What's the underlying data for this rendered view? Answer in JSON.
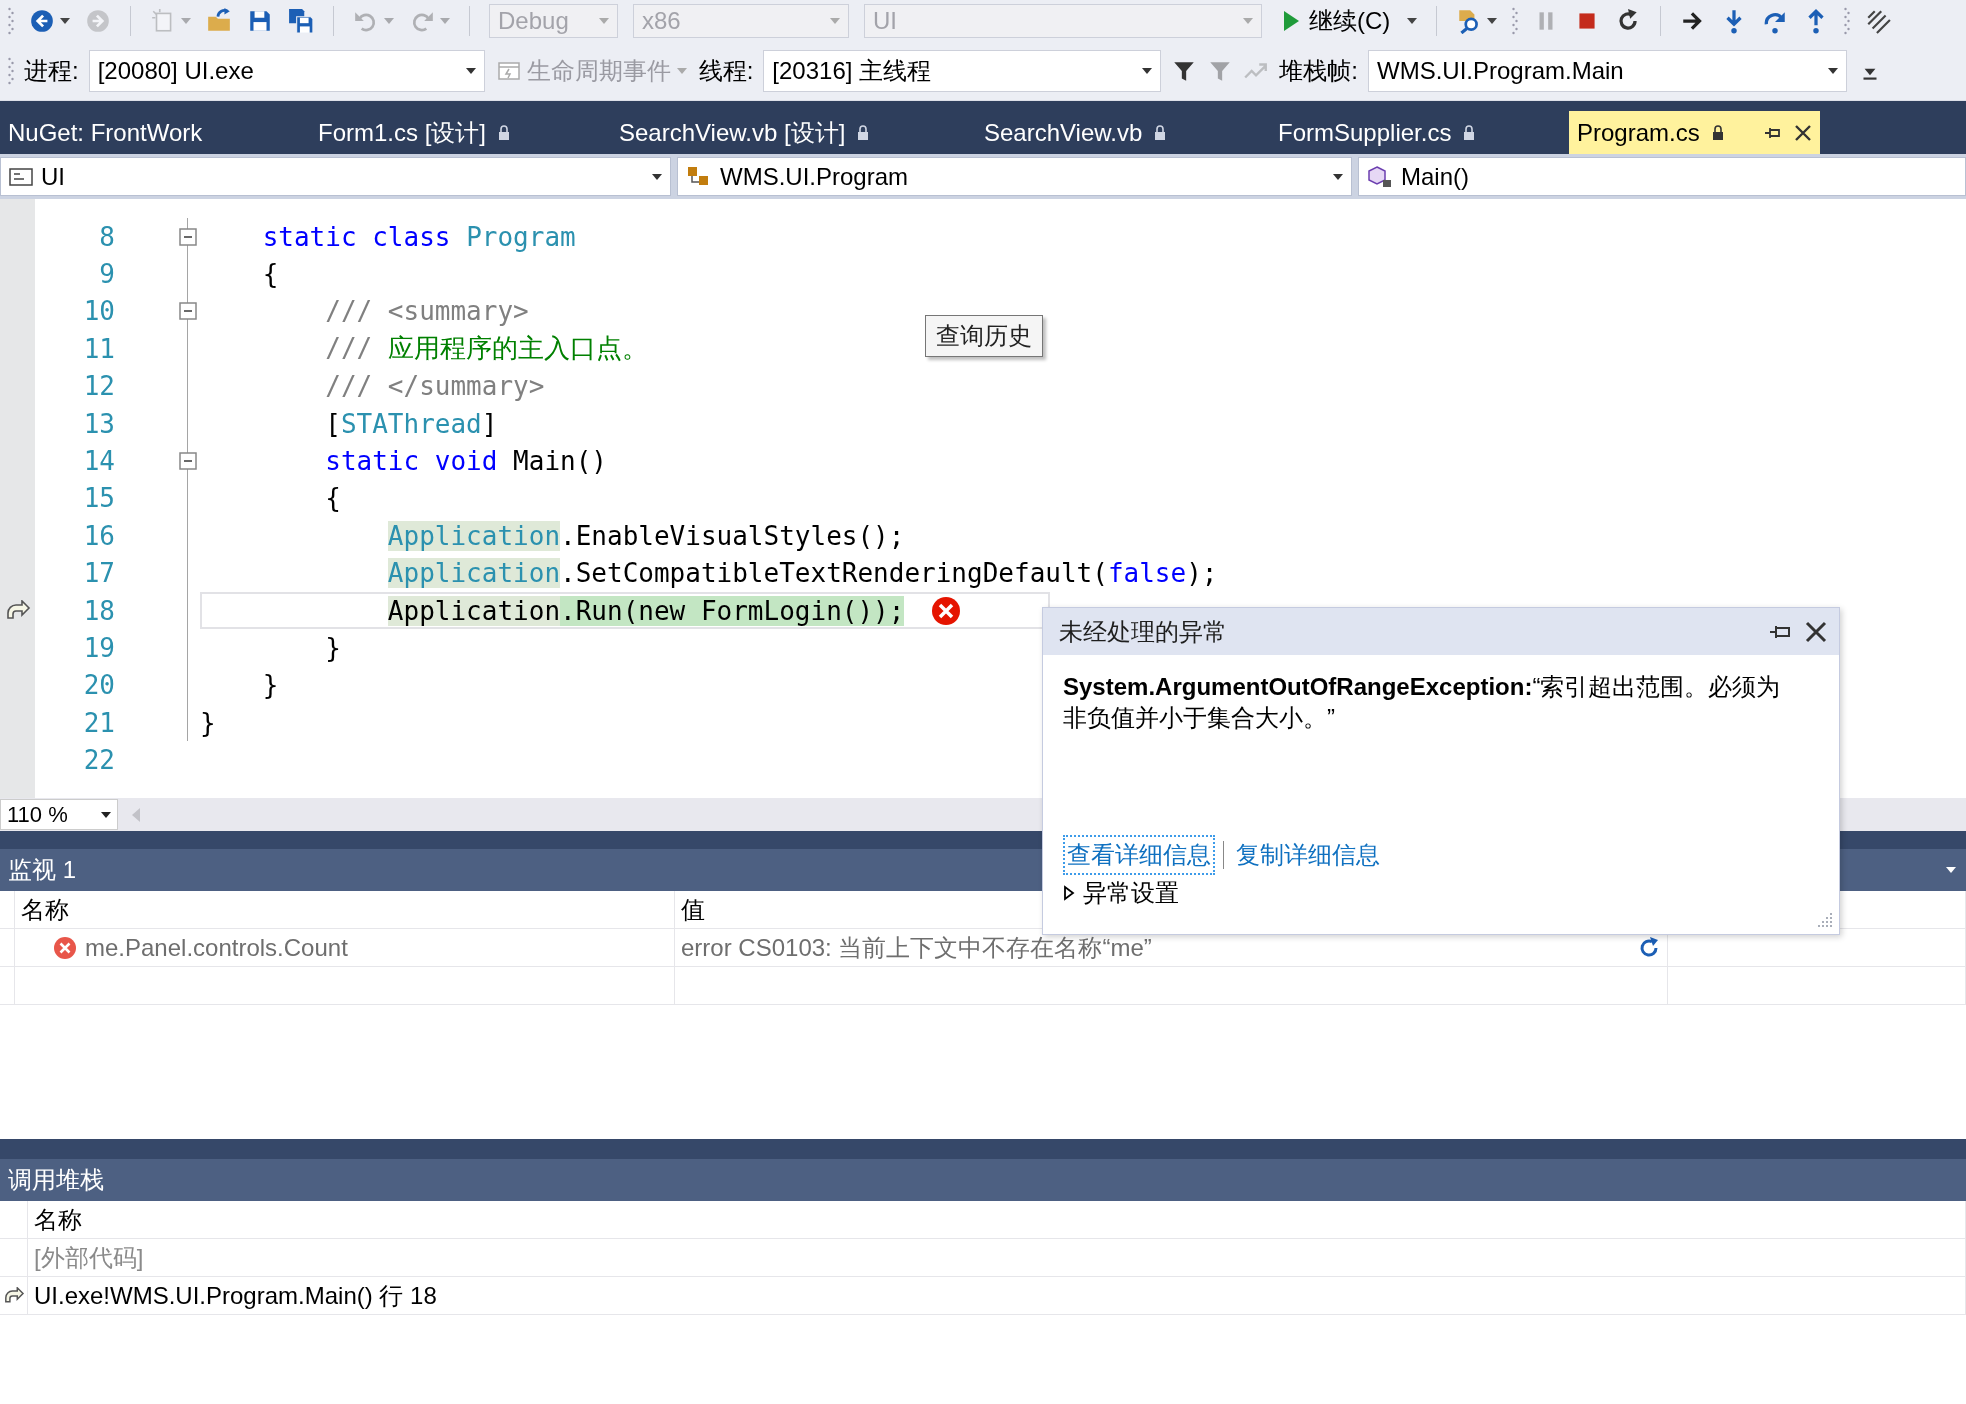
{
  "toolbar": {
    "rows": [
      {
        "items": [
          {
            "kind": "grip"
          },
          {
            "kind": "back",
            "disabled": false,
            "dropdown": true
          },
          {
            "kind": "forward",
            "disabled": true,
            "dropdown": false
          },
          {
            "kind": "separator"
          },
          {
            "kind": "new",
            "disabled": true,
            "dropdown": true
          },
          {
            "kind": "open",
            "disabled": false,
            "dropdown": false
          },
          {
            "kind": "save",
            "disabled": false,
            "dropdown": false
          },
          {
            "kind": "save-all",
            "disabled": false,
            "dropdown": false
          },
          {
            "kind": "separator"
          },
          {
            "kind": "undo",
            "disabled": true,
            "dropdown": true
          },
          {
            "kind": "redo",
            "disabled": true,
            "dropdown": true
          },
          {
            "kind": "separator"
          },
          {
            "kind": "combo",
            "value": "Debug",
            "disabled": true
          },
          {
            "kind": "combo",
            "value": "x86",
            "disabled": true
          },
          {
            "kind": "combo",
            "value": "UI",
            "disabled": true
          },
          {
            "kind": "continue",
            "label": "继续(C)",
            "disabled": false,
            "dropdown": true
          },
          {
            "kind": "separator"
          },
          {
            "kind": "find",
            "disabled": false,
            "dropdown": true
          },
          {
            "kind": "grip"
          },
          {
            "kind": "pause",
            "disabled": true,
            "dropdown": false
          },
          {
            "kind": "stop",
            "disabled": false,
            "dropdown": false
          },
          {
            "kind": "restart",
            "disabled": false,
            "dropdown": false
          },
          {
            "kind": "separator"
          },
          {
            "kind": "show-next",
            "disabled": false,
            "dropdown": false
          },
          {
            "kind": "step-into",
            "disabled": false,
            "dropdown": false
          },
          {
            "kind": "step-over",
            "disabled": false,
            "dropdown": false
          },
          {
            "kind": "step-out",
            "disabled": false,
            "dropdown": false
          },
          {
            "kind": "grip"
          },
          {
            "kind": "hex",
            "disabled": false,
            "dropdown": false
          }
        ]
      },
      {
        "items": [
          {
            "kind": "grip"
          },
          {
            "kind": "label",
            "text": "进程:"
          },
          {
            "kind": "combo",
            "value": "[20080] UI.exe",
            "disabled": false
          },
          {
            "kind": "lifecycle",
            "label": "生命周期事件",
            "disabled": true,
            "dropdown": true
          },
          {
            "kind": "label",
            "text": "线程:"
          },
          {
            "kind": "combo",
            "value": "[20316] 主线程",
            "disabled": false
          },
          {
            "kind": "filter",
            "disabled": false,
            "dropdown": false
          },
          {
            "kind": "filter",
            "disabled": true,
            "dropdown": false
          },
          {
            "kind": "flag",
            "disabled": true,
            "dropdown": false
          },
          {
            "kind": "label",
            "text": "堆栈帧:"
          },
          {
            "kind": "combo",
            "value": "WMS.UI.Program.Main",
            "disabled": false
          },
          {
            "kind": "overflow",
            "disabled": false,
            "dropdown": false
          }
        ]
      }
    ]
  },
  "tabs": [
    {
      "label": "NuGet: FrontWork",
      "selected": false,
      "locked": false
    },
    {
      "label": "Form1.cs [设计]",
      "selected": false,
      "locked": true
    },
    {
      "label": "SearchView.vb [设计]",
      "selected": false,
      "locked": true
    },
    {
      "label": "SearchView.vb",
      "selected": false,
      "locked": true
    },
    {
      "label": "FormSupplier.cs",
      "selected": false,
      "locked": true
    },
    {
      "label": "Program.cs",
      "selected": true,
      "locked": true
    }
  ],
  "navigation_bar": [
    {
      "kind": "project",
      "text": "UI"
    },
    {
      "kind": "class",
      "text": "WMS.UI.Program"
    },
    {
      "kind": "method",
      "text": "Main()"
    }
  ],
  "editor": {
    "lines": [
      {
        "number": "8",
        "foldable": true,
        "current": false,
        "error": false,
        "tokens": [
          {
            "text": "    static class ",
            "kind": "keyword",
            "highlighted": false,
            "executing": false
          },
          {
            "text": "Program",
            "kind": "type",
            "highlighted": false,
            "executing": false
          }
        ]
      },
      {
        "number": "9",
        "foldable": false,
        "current": false,
        "error": false,
        "tokens": [
          {
            "text": "    {",
            "kind": "plain",
            "highlighted": false,
            "executing": false
          }
        ]
      },
      {
        "number": "10",
        "foldable": true,
        "current": false,
        "error": false,
        "tokens": [
          {
            "text": "        /// <summary>",
            "kind": "comment",
            "highlighted": false,
            "executing": false
          }
        ]
      },
      {
        "number": "11",
        "foldable": false,
        "current": false,
        "error": false,
        "tokens": [
          {
            "text": "        /// ",
            "kind": "comment",
            "highlighted": false,
            "executing": false
          },
          {
            "text": "应用程序的主入口点。",
            "kind": "doc",
            "highlighted": false,
            "executing": false
          }
        ]
      },
      {
        "number": "12",
        "foldable": false,
        "current": false,
        "error": false,
        "tokens": [
          {
            "text": "        /// </summary>",
            "kind": "comment",
            "highlighted": false,
            "executing": false
          }
        ]
      },
      {
        "number": "13",
        "foldable": false,
        "current": false,
        "error": false,
        "tokens": [
          {
            "text": "        [",
            "kind": "plain",
            "highlighted": false,
            "executing": false
          },
          {
            "text": "STAThread",
            "kind": "type",
            "highlighted": false,
            "executing": false
          },
          {
            "text": "]",
            "kind": "plain",
            "highlighted": false,
            "executing": false
          }
        ]
      },
      {
        "number": "14",
        "foldable": true,
        "current": false,
        "error": false,
        "tokens": [
          {
            "text": "        static void ",
            "kind": "keyword",
            "highlighted": false,
            "executing": false
          },
          {
            "text": "Main()",
            "kind": "plain",
            "highlighted": false,
            "executing": false
          }
        ]
      },
      {
        "number": "15",
        "foldable": false,
        "current": false,
        "error": false,
        "tokens": [
          {
            "text": "        {",
            "kind": "plain",
            "highlighted": false,
            "executing": false
          }
        ]
      },
      {
        "number": "16",
        "foldable": false,
        "current": false,
        "error": false,
        "tokens": [
          {
            "text": "            Application",
            "kind": "type",
            "highlighted": true,
            "executing": false
          },
          {
            "text": ".EnableVisualStyles();",
            "kind": "plain",
            "highlighted": false,
            "executing": false
          }
        ]
      },
      {
        "number": "17",
        "foldable": false,
        "current": false,
        "error": false,
        "tokens": [
          {
            "text": "            Application",
            "kind": "type",
            "highlighted": true,
            "executing": false
          },
          {
            "text": ".SetCompatibleTextRenderingDefault(",
            "kind": "plain",
            "highlighted": false,
            "executing": false
          },
          {
            "text": "false",
            "kind": "keyword",
            "highlighted": false,
            "executing": false
          },
          {
            "text": ");",
            "kind": "plain",
            "highlighted": false,
            "executing": false
          }
        ]
      },
      {
        "number": "18",
        "foldable": false,
        "current": true,
        "error": true,
        "tokens": [
          {
            "text": "            Application",
            "kind": "plain",
            "highlighted": true,
            "executing": false
          },
          {
            "text": ".Run(new FormLogin());",
            "kind": "plain",
            "highlighted": false,
            "executing": true
          }
        ]
      },
      {
        "number": "19",
        "foldable": false,
        "current": false,
        "error": false,
        "tokens": [
          {
            "text": "        }",
            "kind": "plain",
            "highlighted": false,
            "executing": false
          }
        ]
      },
      {
        "number": "20",
        "foldable": false,
        "current": false,
        "error": false,
        "tokens": [
          {
            "text": "    }",
            "kind": "plain",
            "highlighted": false,
            "executing": false
          }
        ]
      },
      {
        "number": "21",
        "foldable": false,
        "current": false,
        "error": false,
        "tokens": [
          {
            "text": "}",
            "kind": "plain",
            "highlighted": false,
            "executing": false
          }
        ]
      },
      {
        "number": "22",
        "foldable": false,
        "current": false,
        "error": false
      }
    ],
    "zoom": "110 %"
  },
  "tooltip": {
    "text": "查询历史"
  },
  "exception_popup": {
    "title": "未经处理的异常",
    "message": "**System.ArgumentOutOfRangeException:**“索引超出范围。必须为非负值并小于集合大小。”",
    "links": [
      {
        "text": "查看详细信息",
        "focused": true
      },
      {
        "text": "复制详细信息",
        "focused": false
      }
    ],
    "settings": {
      "label": "异常设置",
      "expanded": false
    }
  },
  "watch": {
    "title": "监视 1",
    "columns": [
      "名称",
      "值"
    ],
    "rows": [
      {
        "error": true,
        "name": "me.Panel.controls.Count",
        "value": "error CS0103: 当前上下文中不存在名称“me”",
        "refreshable": true
      }
    ]
  },
  "call_stack": {
    "title": "调用堆栈",
    "columns": [
      "名称"
    ],
    "rows": [
      {
        "name": "[外部代码]",
        "external": true,
        "current": false
      },
      {
        "name": "UI.exe!WMS.UI.Program.Main() 行 18",
        "external": false,
        "current": true
      }
    ]
  }
}
